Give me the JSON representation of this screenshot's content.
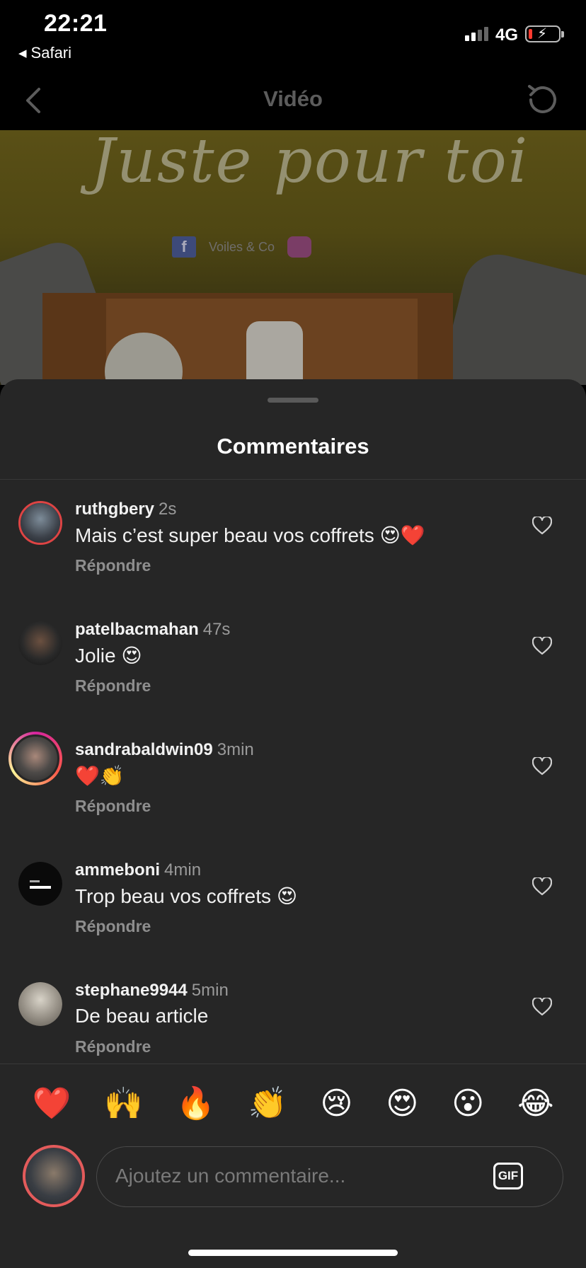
{
  "status_bar": {
    "time": "22:21",
    "back_app": "Safari",
    "network": "4G",
    "battery_level": 0.1,
    "charging": true
  },
  "header": {
    "title": "Vidéo"
  },
  "video": {
    "overlay_text": "Juste pour toi",
    "brand_text": "Voiles & Co"
  },
  "comments_sheet": {
    "title": "Commentaires",
    "reply_label": "Répondre",
    "comments": [
      {
        "user": "ruthgbery",
        "age": "2s",
        "text": "Mais c’est super beau vos coffrets 😍❤️",
        "avatar_ring": false
      },
      {
        "user": "patelbacmahan",
        "age": "47s",
        "text": "Jolie 😍",
        "avatar_ring": false
      },
      {
        "user": "sandrabaldwin09",
        "age": "3min",
        "text": "❤️👏",
        "avatar_ring": true
      },
      {
        "user": "ammeboni",
        "age": "4min",
        "text": "Trop beau vos coffrets 😍",
        "avatar_ring": false
      },
      {
        "user": "stephane9944",
        "age": "5min",
        "text": "De beau article",
        "avatar_ring": false
      }
    ]
  },
  "quick_reactions": [
    "❤️",
    "🙌",
    "🔥",
    "👏",
    "😢",
    "😍",
    "😮",
    "😂"
  ],
  "composer": {
    "placeholder": "Ajoutez un commentaire...",
    "gif_label": "GIF"
  },
  "colors": {
    "sheet_bg": "#262626",
    "muted_text": "#8e8e8e",
    "header_title": "#5c5c5c"
  }
}
